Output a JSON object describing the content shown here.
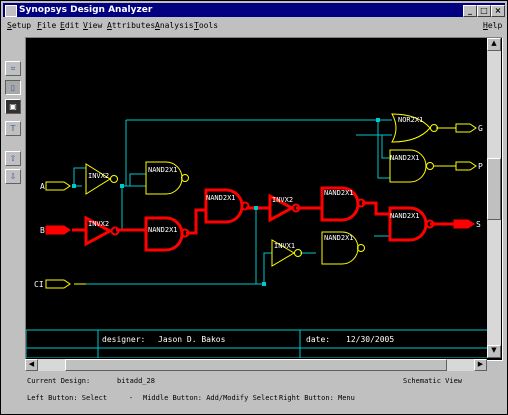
{
  "window": {
    "title": "Synopsys Design Analyzer"
  },
  "menu": {
    "items": [
      "Setup",
      "File",
      "Edit",
      "View",
      "Attributes",
      "Analysis",
      "Tools"
    ],
    "help": "Help"
  },
  "toolbar": {
    "tools": [
      "select-tool",
      "symbol-tool",
      "schematic-tool",
      "text-tool",
      "up-tool",
      "down-tool"
    ]
  },
  "schematic": {
    "ports": {
      "a": "A",
      "b": "B",
      "ci": "CI",
      "g": "G",
      "p": "P",
      "s": "S"
    },
    "gates": {
      "inv_a": "INVX2",
      "nand_a": "NAND2X1",
      "inv_b": "INVX2",
      "nand_b": "NAND2X1",
      "nand_mid": "NAND2X1",
      "inv_mid": "INVX2",
      "inv_lower": "INVX1",
      "nand_up": "NAND2X1",
      "nand_low": "NAND2X1",
      "nand_s": "NAND2X1",
      "nor_g": "NOR2X1",
      "nand_p": "NAND2X1"
    },
    "title_block": {
      "designer_label": "designer:",
      "designer": "Jason D. Bakos",
      "date_label": "date:",
      "date": "12/30/2005"
    },
    "colors": {
      "background": "#000000",
      "highlight": "#ff0000",
      "gate": "#ffff00",
      "wire": "#00c8c8",
      "port": "#ffff00"
    }
  },
  "status": {
    "current_design_label": "Current Design:",
    "current_design": "bitadd_28",
    "view": "Schematic View",
    "left_button": "Left Button: Select",
    "middle_button": "Middle Button: Add/Modify Select",
    "right_button": "Right Button: Menu",
    "separator": "-"
  }
}
